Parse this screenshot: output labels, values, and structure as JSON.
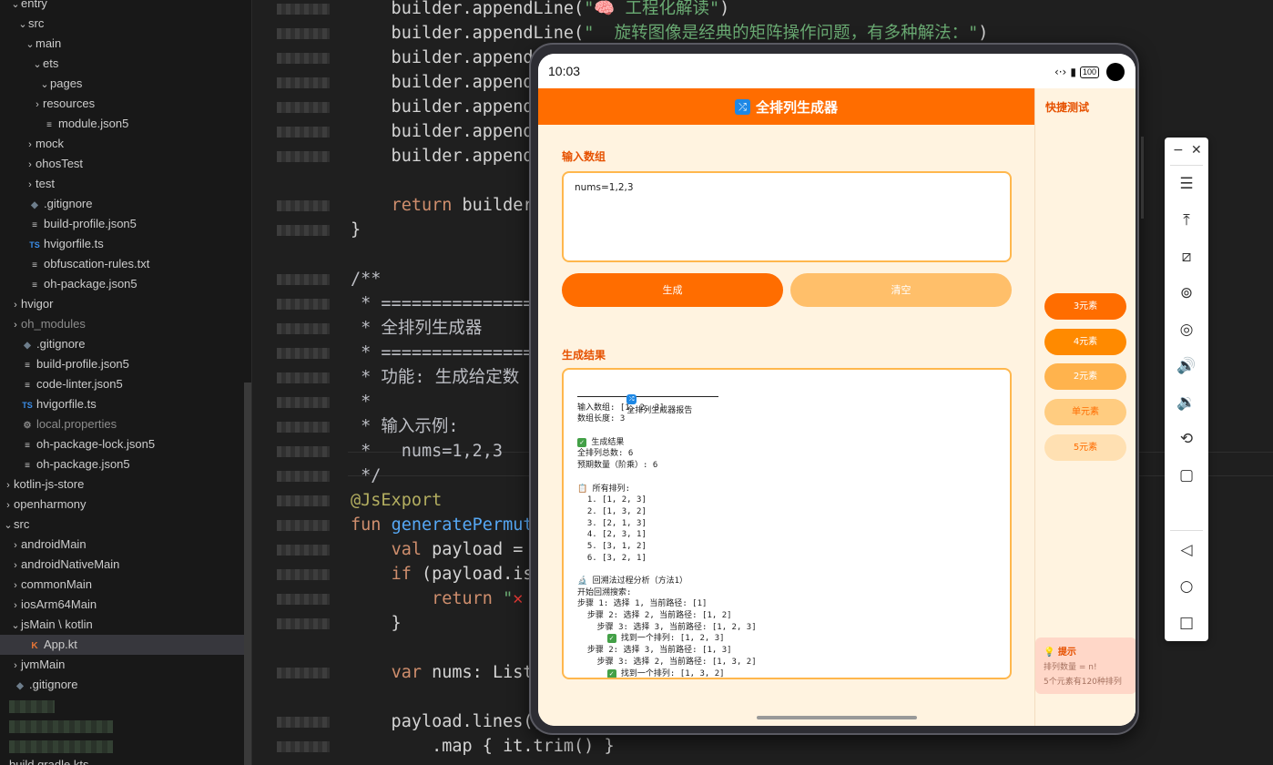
{
  "sidebar": {
    "items": [
      {
        "label": "entry",
        "chev": "⌄",
        "icon": "",
        "depth": 0
      },
      {
        "label": "src",
        "chev": "⌄",
        "icon": "",
        "depth": 1
      },
      {
        "label": "main",
        "chev": "⌄",
        "icon": "",
        "depth": 2
      },
      {
        "label": "ets",
        "chev": "⌄",
        "icon": "",
        "depth": 3
      },
      {
        "label": "pages",
        "chev": "⌄",
        "icon": "",
        "depth": 4
      },
      {
        "label": "resources",
        "chev": "›",
        "icon": "",
        "depth": 3
      },
      {
        "label": "module.json5",
        "chev": "",
        "icon": "json",
        "depth": 3
      },
      {
        "label": "mock",
        "chev": "›",
        "icon": "",
        "depth": 2
      },
      {
        "label": "ohosTest",
        "chev": "›",
        "icon": "",
        "depth": 2
      },
      {
        "label": "test",
        "chev": "›",
        "icon": "",
        "depth": 2
      },
      {
        "label": ".gitignore",
        "chev": "",
        "icon": "git",
        "depth": 1
      },
      {
        "label": "build-profile.json5",
        "chev": "",
        "icon": "json",
        "depth": 1
      },
      {
        "label": "hvigorfile.ts",
        "chev": "",
        "icon": "ts",
        "depth": 1
      },
      {
        "label": "obfuscation-rules.txt",
        "chev": "",
        "icon": "json",
        "depth": 1
      },
      {
        "label": "oh-package.json5",
        "chev": "",
        "icon": "json",
        "depth": 1
      },
      {
        "label": "hvigor",
        "chev": "›",
        "icon": "",
        "depth": 0
      },
      {
        "label": "oh_modules",
        "chev": "›",
        "icon": "",
        "depth": 0,
        "dim": true
      },
      {
        "label": ".gitignore",
        "chev": "",
        "icon": "git",
        "depth": 0
      },
      {
        "label": "build-profile.json5",
        "chev": "",
        "icon": "json",
        "depth": 0
      },
      {
        "label": "code-linter.json5",
        "chev": "",
        "icon": "json",
        "depth": 0
      },
      {
        "label": "hvigorfile.ts",
        "chev": "",
        "icon": "ts",
        "depth": 0
      },
      {
        "label": "local.properties",
        "chev": "",
        "icon": "gear",
        "depth": 0,
        "dim": true
      },
      {
        "label": "oh-package-lock.json5",
        "chev": "",
        "icon": "json",
        "depth": 0
      },
      {
        "label": "oh-package.json5",
        "chev": "",
        "icon": "json",
        "depth": 0
      },
      {
        "label": "kotlin-js-store",
        "chev": "›",
        "icon": "",
        "depth": -1
      },
      {
        "label": "openharmony",
        "chev": "›",
        "icon": "",
        "depth": -1
      },
      {
        "label": "src",
        "chev": "⌄",
        "icon": "",
        "depth": -1
      },
      {
        "label": "androidMain",
        "chev": "›",
        "icon": "",
        "depth": 0
      },
      {
        "label": "androidNativeMain",
        "chev": "›",
        "icon": "",
        "depth": 0
      },
      {
        "label": "commonMain",
        "chev": "›",
        "icon": "",
        "depth": 0
      },
      {
        "label": "iosArm64Main",
        "chev": "›",
        "icon": "",
        "depth": 0
      },
      {
        "label": "jsMain \\ kotlin",
        "chev": "⌄",
        "icon": "",
        "depth": 0
      },
      {
        "label": "App.kt",
        "chev": "",
        "icon": "kt",
        "depth": 1,
        "selected": true
      },
      {
        "label": "jvmMain",
        "chev": "›",
        "icon": "",
        "depth": 0
      },
      {
        "label": ".gitignore",
        "chev": "",
        "icon": "git",
        "depth": -1
      }
    ],
    "bottom_item": "build.gradle.kts"
  },
  "editor": {
    "lines": [
      {
        "html": "    builder.appendLine(<span class=\"str\">\"🧠 工程化解读\"</span>)"
      },
      {
        "html": "    builder.appendLine(<span class=\"str\">\"  旋转图像是经典的矩阵操作问题，有多种解法：\"</span>)"
      },
      {
        "html": "    builder.append"
      },
      {
        "html": "    builder.append"
      },
      {
        "html": "    builder.append"
      },
      {
        "html": "    builder.append"
      },
      {
        "html": "    builder.append"
      },
      {
        "html": ""
      },
      {
        "html": "    <span class=\"kw\">return</span> builder"
      },
      {
        "html": "}"
      },
      {
        "html": ""
      },
      {
        "html": "<span class=\"cm\">/**</span>"
      },
      {
        "html": "<span class=\"cm\"> * ===============</span>"
      },
      {
        "html": "<span class=\"cm\"> * 全排列生成器</span>"
      },
      {
        "html": "<span class=\"cm\"> * ===============</span>"
      },
      {
        "html": "<span class=\"cm\"> * 功能: 生成给定数</span>"
      },
      {
        "html": "<span class=\"cm\"> *</span>"
      },
      {
        "html": "<span class=\"cm\"> * 输入示例:</span>"
      },
      {
        "html": "<span class=\"cm\"> *   nums=1,2,3</span>"
      },
      {
        "html": "<span class=\"cm\"> */</span>"
      },
      {
        "html": "<span class=\"ann\">@JsExport</span>"
      },
      {
        "html": "<span class=\"kw\">fun</span> <span class=\"fn\">generatePermut</span>"
      },
      {
        "html": "    <span class=\"kw\">val</span> payload = "
      },
      {
        "html": "    <span class=\"kw\">if</span> (payload.is"
      },
      {
        "html": "        <span class=\"kw\">return</span> <span class=\"str\">\"</span><span style=\"color:#e53935\">✕</span>"
      },
      {
        "html": "    }"
      },
      {
        "html": ""
      },
      {
        "html": "    <span class=\"kw\">var</span> nums: List"
      },
      {
        "html": ""
      },
      {
        "html": "    payload.lines()"
      },
      {
        "html": "        .map { it.trim() }"
      }
    ]
  },
  "phone": {
    "status_time": "10:03",
    "battery": "100",
    "app_title": "全排列生成器",
    "quick_title": "快捷测试",
    "quick_buttons": [
      {
        "label": "3元素",
        "color": "#ff6d00"
      },
      {
        "label": "4元素",
        "color": "#ff8a00"
      },
      {
        "label": "2元素",
        "color": "#ffb34d"
      },
      {
        "label": "单元素",
        "color": "#ffcc80"
      },
      {
        "label": "5元素",
        "color": "#ffe0b2"
      }
    ],
    "tip": {
      "title": "💡 提示",
      "line1": "排列数量 = n!",
      "line2": "5个元素有120种排列"
    },
    "input_section_title": "输入数组",
    "input_value": "nums=1,2,3",
    "generate_label": "生成",
    "clear_label": "清空",
    "result_section_title": "生成结果",
    "result_title": "全排列生成器报告",
    "result_lines": [
      "输入数组: [1, 2, 3]",
      "数组长度: 3",
      "",
      "✅ 生成结果",
      "全排列总数: 6",
      "预期数量（阶乘）: 6",
      "",
      "📋 所有排列:",
      "  1. [1, 2, 3]",
      "  2. [1, 3, 2]",
      "  3. [2, 1, 3]",
      "  4. [2, 3, 1]",
      "  5. [3, 1, 2]",
      "  6. [3, 2, 1]",
      "",
      "🔬 回溯法过程分析（方法1）",
      "开始回溯搜索:",
      "步骤 1: 选择 1, 当前路径: [1]",
      "  步骤 2: 选择 2, 当前路径: [1, 2]",
      "    步骤 3: 选择 3, 当前路径: [1, 2, 3]",
      "      ✅ 找到一个排列: [1, 2, 3]",
      "  步骤 2: 选择 3, 当前路径: [1, 3]",
      "    步骤 3: 选择 2, 当前路径: [1, 3, 2]",
      "      ✅ 找到一个排列: [1, 3, 2]"
    ]
  },
  "toolbar": {
    "minimize": "−",
    "close": "✕",
    "buttons": [
      "☰",
      "⤒",
      "⧄",
      "⊚",
      "◎",
      "🔊",
      "🔉",
      "⟲",
      "▢",
      "◁",
      "○",
      "□"
    ]
  }
}
